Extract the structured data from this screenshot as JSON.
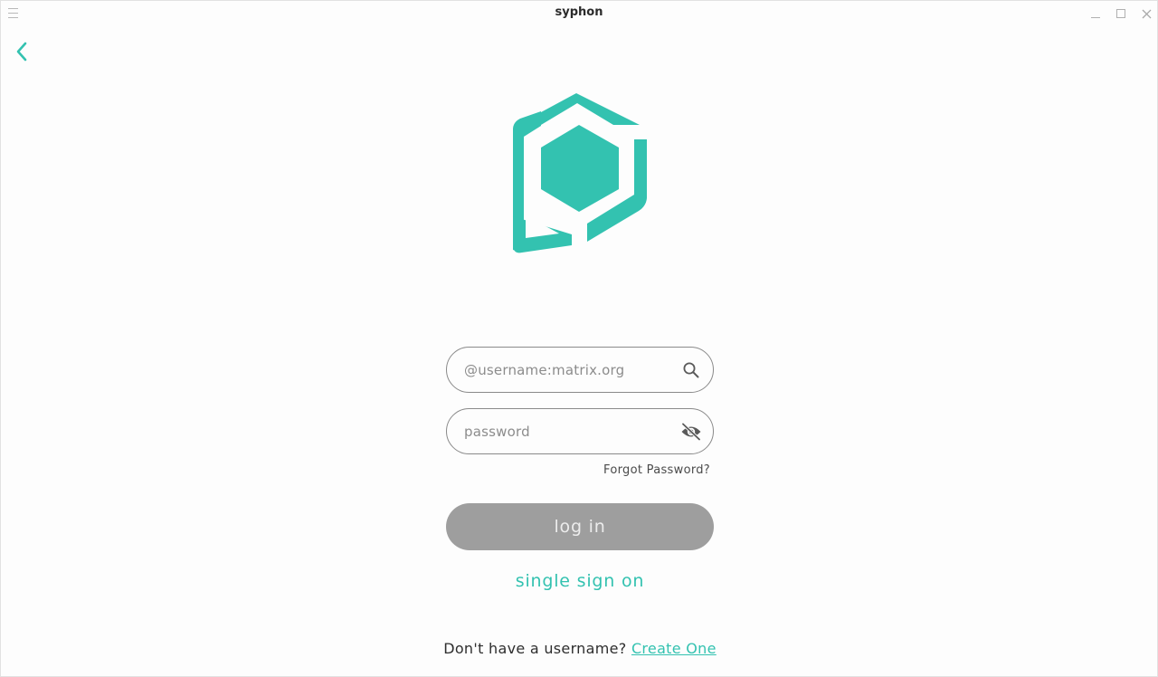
{
  "window": {
    "title": "syphon"
  },
  "colors": {
    "accent": "#33c2b0",
    "button_disabled": "#9e9e9e",
    "field_border": "#8a8a8a"
  },
  "login": {
    "username_placeholder": "@username:matrix.org",
    "username_icon": "search-icon",
    "password_placeholder": "password",
    "password_icon": "visibility-off-icon",
    "forgot_label": "Forgot Password?",
    "login_label": "log in",
    "sso_label": "single sign on",
    "signup_prompt": "Don't have a username? ",
    "signup_link": "Create One"
  }
}
